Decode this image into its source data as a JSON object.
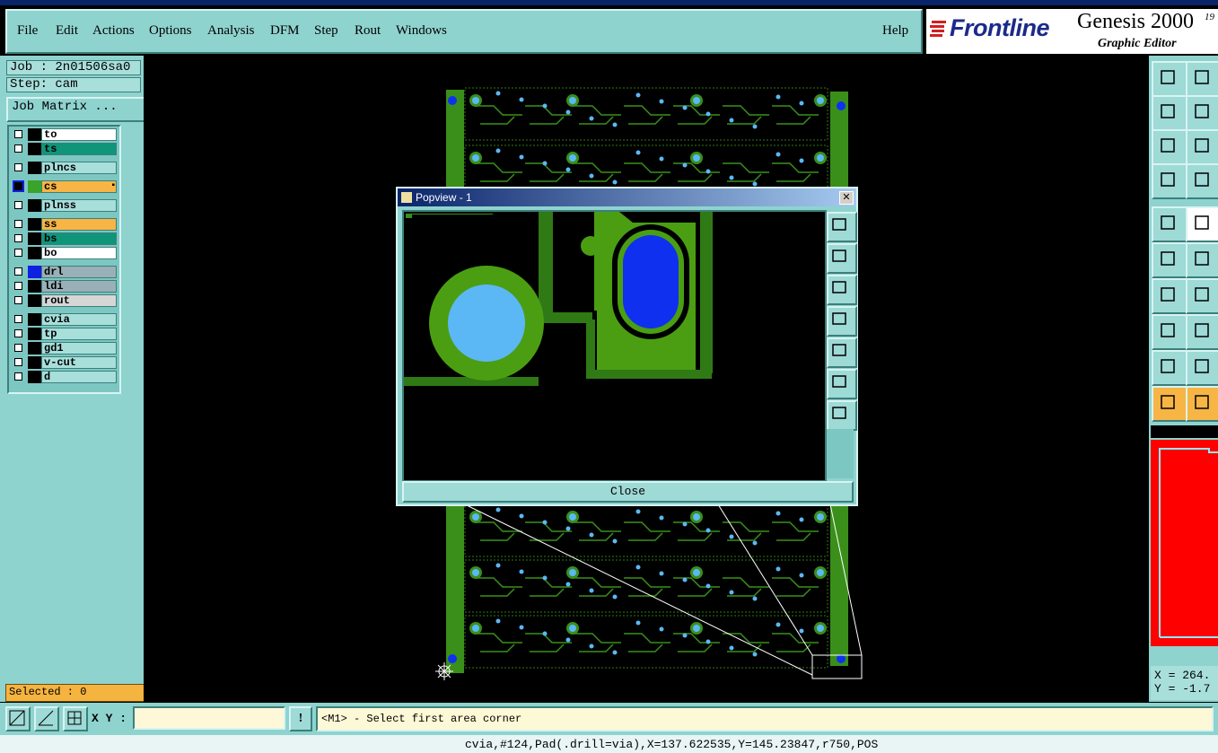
{
  "window": {
    "title": "Graphic Editor Genesis"
  },
  "menu": {
    "items": [
      "File",
      "Edit",
      "Actions",
      "Options",
      "Analysis",
      "DFM",
      "Step",
      "Rout",
      "Windows"
    ],
    "help": "Help"
  },
  "brand": {
    "logo": "Frontline",
    "product": "Genesis 2000",
    "subtitle": "Graphic Editor",
    "sup": "19"
  },
  "job": {
    "job_label": "Job : 2n01506sa0",
    "step_label": "Step: cam",
    "matrix_button": "Job Matrix ..."
  },
  "layers": [
    {
      "name": "to",
      "color": "#ffffff",
      "swatch": "#000000"
    },
    {
      "name": "ts",
      "color": "#10957a",
      "swatch": "#000000"
    },
    {
      "name": "plncs",
      "color": "#a8dfdb",
      "swatch": "#000000"
    },
    {
      "name": "cs",
      "color": "#f7b545",
      "swatch": "#3aa32a",
      "active": true
    },
    {
      "name": "plnss",
      "color": "#a8dfdb",
      "swatch": "#000000"
    },
    {
      "name": "ss",
      "color": "#f7b545",
      "swatch": "#000000"
    },
    {
      "name": "bs",
      "color": "#10957a",
      "swatch": "#000000"
    },
    {
      "name": "bo",
      "color": "#ffffff",
      "swatch": "#000000"
    },
    {
      "name": "drl",
      "color": "#9ab0b8",
      "swatch": "#1020e0"
    },
    {
      "name": "ldi",
      "color": "#9ab0b8",
      "swatch": "#000000"
    },
    {
      "name": "rout",
      "color": "#d6d6d6",
      "swatch": "#000000"
    },
    {
      "name": "cvia",
      "color": "#a8dfdb",
      "swatch": "#000000"
    },
    {
      "name": "tp",
      "color": "#a8dfdb",
      "swatch": "#000000"
    },
    {
      "name": "gd1",
      "color": "#a8dfdb",
      "swatch": "#000000"
    },
    {
      "name": "v-cut",
      "color": "#a8dfdb",
      "swatch": "#000000"
    },
    {
      "name": "d",
      "color": "#a8dfdb",
      "swatch": "#000000"
    }
  ],
  "selected": "Selected : 0",
  "popview": {
    "title": "Popview - 1",
    "close_label": "Close"
  },
  "command": {
    "xy_label": "X Y :",
    "xy_value": "",
    "prompt": "<M1> - Select first area corner"
  },
  "coords": {
    "x_label": "X = 264.",
    "y_label": "Y = -1.7"
  },
  "status": {
    "text": "cvia,#124,Pad(.drill=via),X=137.622535,Y=145.23847,r750,POS"
  },
  "colors": {
    "panel": "#8fd3cf",
    "board": "#3a8f1a",
    "pad": "#5bb8f5",
    "drill": "#1030f0",
    "highlight": "#f7b545"
  }
}
